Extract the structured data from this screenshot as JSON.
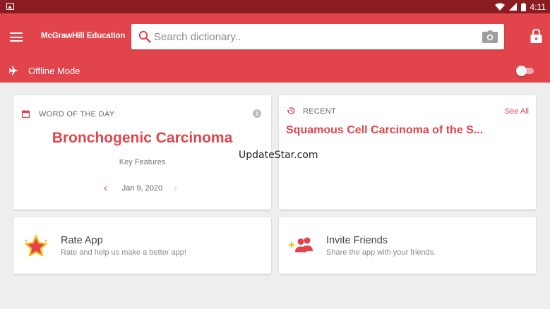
{
  "status_bar": {
    "time": "4:11"
  },
  "app_bar": {
    "brand": "McGrawHill Education",
    "search_placeholder": "Search dictionary..",
    "offline_label": "Offline Mode"
  },
  "word_of_the_day": {
    "header": "WORD OF THE DAY",
    "word": "Bronchogenic Carcinoma",
    "subtitle": "Key Features",
    "date": "Jan 9, 2020"
  },
  "recent": {
    "header": "RECENT",
    "see_all": "See All",
    "word": "Squamous Cell Carcinoma of the S..."
  },
  "rate_app": {
    "title": "Rate App",
    "subtitle": "Rate and help us make a better app!"
  },
  "invite_friends": {
    "title": "Invite Friends",
    "subtitle": "Share the app with your friends."
  },
  "watermark": "UpdateStar.com",
  "colors": {
    "accent": "#e2444c",
    "status_bar": "#8c1c24",
    "background": "#eeeeee"
  }
}
